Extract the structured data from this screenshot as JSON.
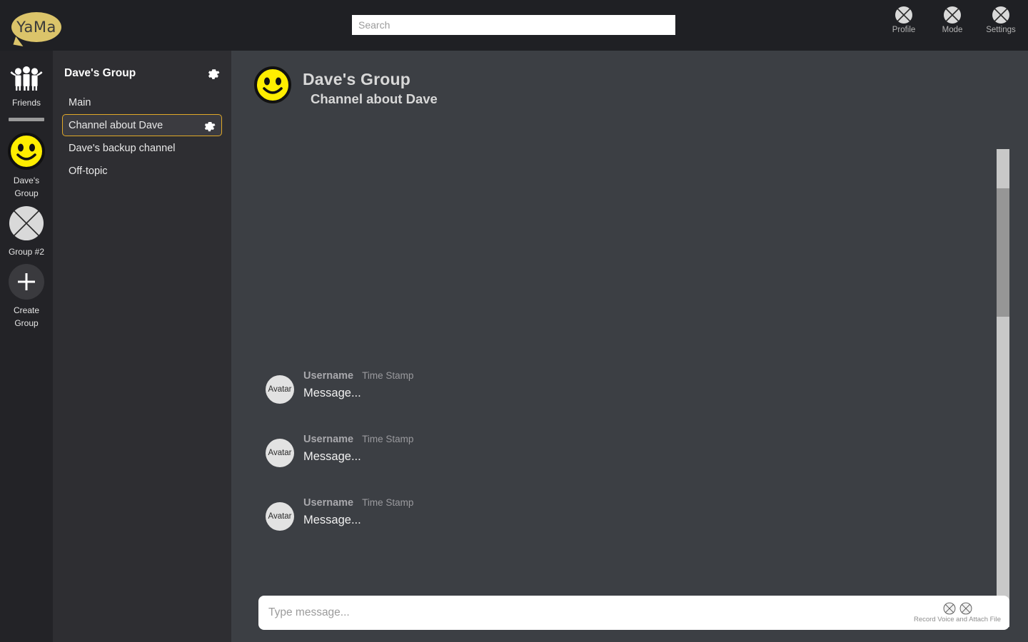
{
  "app": {
    "logo_text": "YaMa",
    "accent_color": "#e0a828",
    "brand_color": "#dbc46a"
  },
  "topbar": {
    "search": {
      "placeholder": "Search",
      "value": ""
    },
    "actions": [
      {
        "label": "Profile",
        "icon": "x-circle-icon"
      },
      {
        "label": "Mode",
        "icon": "x-circle-icon"
      },
      {
        "label": "Settings",
        "icon": "x-circle-icon"
      }
    ]
  },
  "rail": {
    "items": [
      {
        "label": "Friends",
        "icon": "friends-group-icon"
      },
      {
        "label": "Dave's Group",
        "icon": "smiley-face-icon"
      },
      {
        "label": "Group #2",
        "icon": "x-circle-icon"
      },
      {
        "label": "Create Group",
        "icon": "plus-icon"
      }
    ]
  },
  "sidebar": {
    "group_title": "Dave's Group",
    "settings_icon": "gear-icon",
    "channels": [
      {
        "name": "Main",
        "selected": false
      },
      {
        "name": "Channel about Dave",
        "selected": true
      },
      {
        "name": "Dave's backup channel",
        "selected": false
      },
      {
        "name": "Off-topic",
        "selected": false
      }
    ]
  },
  "chat": {
    "avatar_icon": "smiley-face-icon",
    "title": "Dave's Group",
    "subtitle": "Channel about Dave",
    "messages": [
      {
        "avatar": "Avatar",
        "username": "Username",
        "timestamp": "Time Stamp",
        "text": "Message..."
      },
      {
        "avatar": "Avatar",
        "username": "Username",
        "timestamp": "Time Stamp",
        "text": "Message..."
      },
      {
        "avatar": "Avatar",
        "username": "Username",
        "timestamp": "Time Stamp",
        "text": "Message..."
      }
    ],
    "composer": {
      "placeholder": "Type message...",
      "value": "",
      "caption": "Record Voice and Attach File",
      "icons": [
        "record-voice-icon",
        "attach-file-icon"
      ]
    }
  }
}
